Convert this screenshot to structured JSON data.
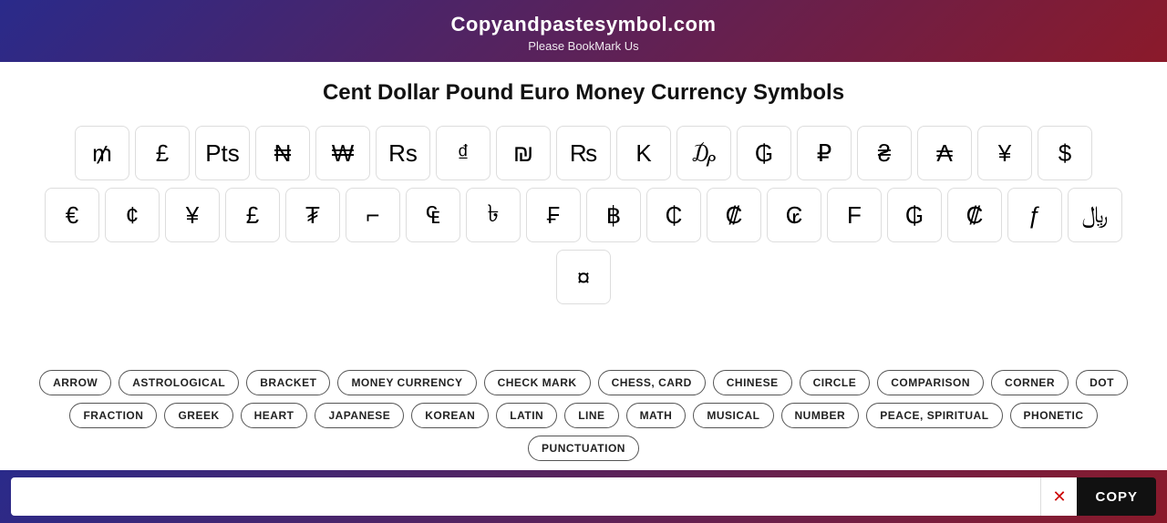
{
  "header": {
    "title": "Copyandpastesymbol.com",
    "subtitle": "Please BookMark Us"
  },
  "page": {
    "title": "Cent Dollar Pound Euro Money Currency Symbols"
  },
  "symbols": {
    "row1": [
      "₥",
      "£",
      "Pts",
      "₦",
      "₩",
      "Rs",
      "₫",
      "₪",
      "₨",
      "K",
      "₯",
      "₲",
      "₽",
      "₴",
      "₳",
      "¥",
      "$"
    ],
    "row2": [
      "€",
      "¢",
      "¥",
      "£",
      "₮",
      "⌐",
      "₠",
      "৳",
      "₣",
      "฿",
      "₵",
      "₡",
      "₢",
      "F",
      "₲",
      "₡",
      "ƒ",
      "﷼"
    ],
    "row3": [
      "¤"
    ]
  },
  "categories": {
    "row1": [
      {
        "label": "ARROW",
        "active": false
      },
      {
        "label": "ASTROLOGICAL",
        "active": false
      },
      {
        "label": "BRACKET",
        "active": false
      },
      {
        "label": "MONEY CURRENCY",
        "active": false
      },
      {
        "label": "CHECK MARK",
        "active": false
      },
      {
        "label": "CHESS, CARD",
        "active": false
      },
      {
        "label": "CHINESE",
        "active": false
      },
      {
        "label": "CIRCLE",
        "active": false
      },
      {
        "label": "COMPARISON",
        "active": false
      },
      {
        "label": "CORNER",
        "active": false
      },
      {
        "label": "DOT",
        "active": false
      }
    ],
    "row2": [
      {
        "label": "FRACTION",
        "active": false
      },
      {
        "label": "GREEK",
        "active": false
      },
      {
        "label": "HEART",
        "active": false
      },
      {
        "label": "JAPANESE",
        "active": false
      },
      {
        "label": "KOREAN",
        "active": false
      },
      {
        "label": "LATIN",
        "active": false
      },
      {
        "label": "LINE",
        "active": false
      },
      {
        "label": "MATH",
        "active": false
      },
      {
        "label": "MUSICAL",
        "active": false
      },
      {
        "label": "NUMBER",
        "active": false
      },
      {
        "label": "PEACE, SPIRITUAL",
        "active": false
      },
      {
        "label": "PHONETIC",
        "active": false
      },
      {
        "label": "PUNCTUATION",
        "active": false
      }
    ]
  },
  "bottom_bar": {
    "input_placeholder": "",
    "clear_icon": "✕",
    "copy_label": "COPY"
  }
}
